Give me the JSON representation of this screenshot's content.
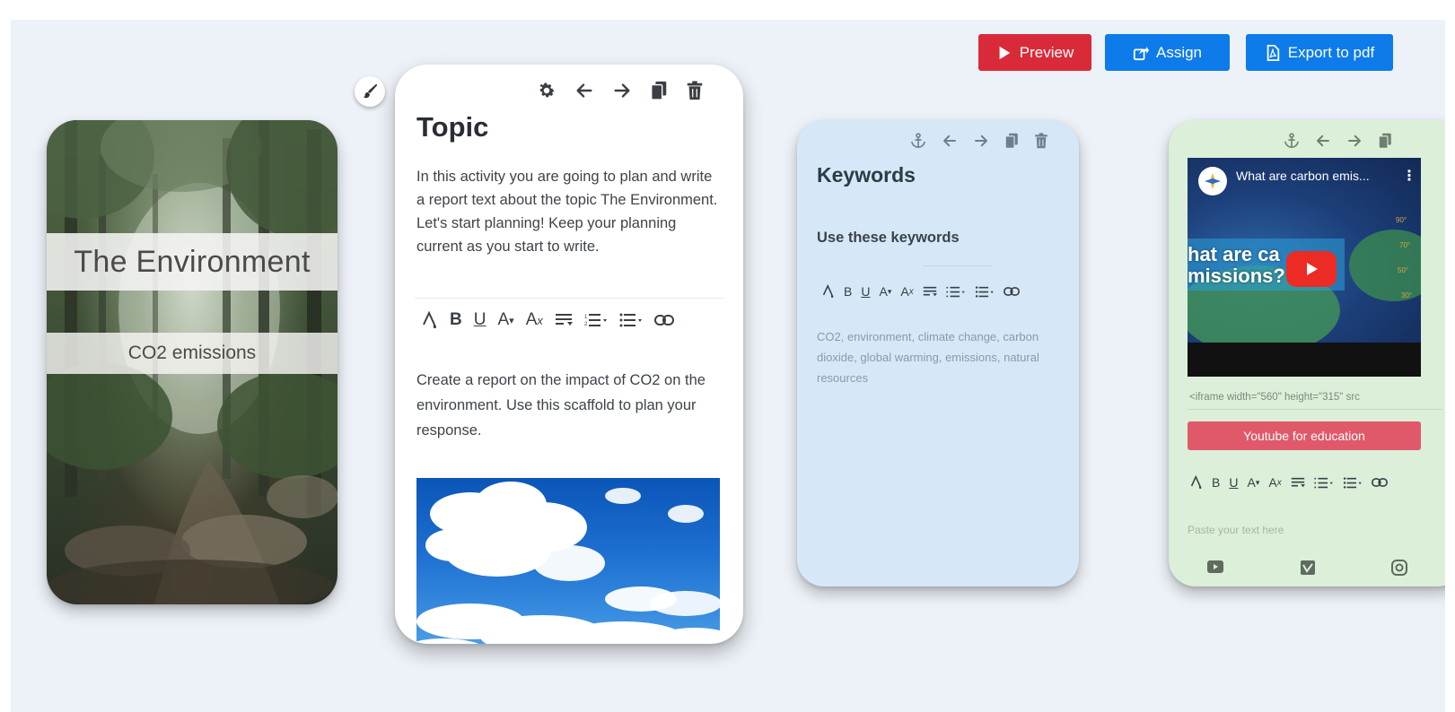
{
  "toolbar": {
    "preview_label": "Preview",
    "assign_label": "Assign",
    "export_label": "Export to pdf",
    "colors": {
      "preview": "#d92a3a",
      "assign": "#0d7bea",
      "export": "#0d7bea"
    }
  },
  "cover": {
    "title": "The Environment",
    "subtitle": "CO2 emissions"
  },
  "topic": {
    "title": "Topic",
    "intro": "In this activity you are going to plan and write a report text about the topic The Environment. Let's start planning! Keep your planning current as you start to write.",
    "prompt": "Create a report on the impact of CO2 on the environment. Use this scaffold to plan your response.",
    "tools": [
      "gear-icon",
      "arrow-left-icon",
      "arrow-right-icon",
      "copy-icon",
      "trash-icon"
    ]
  },
  "editor_toolbar": {
    "bold": "B",
    "underline": "U",
    "font_size": "A",
    "clear_format": "A",
    "icons": [
      "text-color-icon",
      "bold-icon",
      "underline-icon",
      "font-size-icon",
      "clear-format-icon",
      "paragraph-icon",
      "ordered-list-icon",
      "unordered-list-icon",
      "link-icon"
    ]
  },
  "keywords": {
    "title": "Keywords",
    "subtitle": "Use these keywords",
    "list": "CO2, environment, climate change, carbon dioxide, global warming, emissions, natural resources",
    "background": "#d6e8f7"
  },
  "video": {
    "video_title": "What are carbon emis...",
    "overlay_text": "hat are ca\nmissions?",
    "embed_value": "<iframe width=\"560\" height=\"315\" src",
    "youtube_edu_label": "Youtube for education",
    "paste_placeholder": "Paste your text here",
    "background": "#dcefd9",
    "sources": [
      "youtube-icon",
      "vimeo-icon",
      "instagram-icon"
    ]
  }
}
